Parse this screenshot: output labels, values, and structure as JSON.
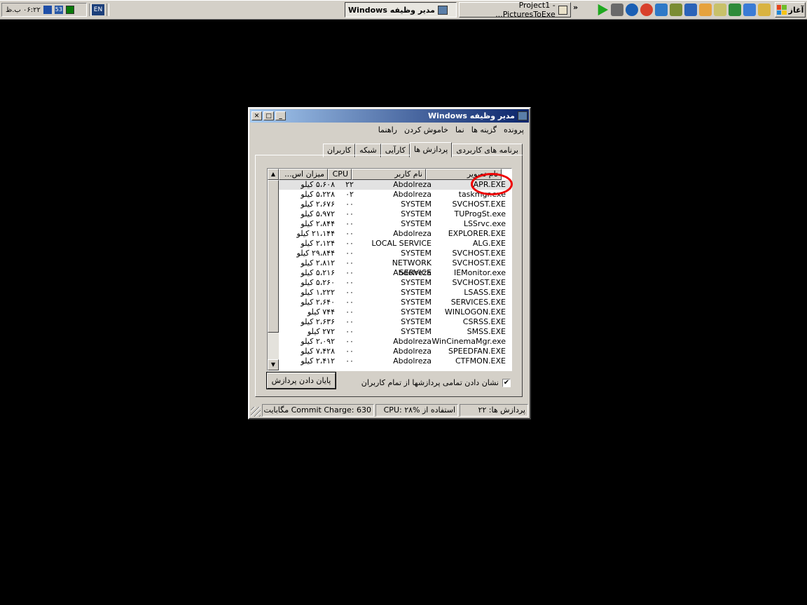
{
  "taskbar": {
    "start_label": "آغاز",
    "tasks": [
      {
        "label": "Project1 - PicturesToExe..."
      },
      {
        "label": "مدير وظيفه Windows"
      }
    ],
    "lang": "EN",
    "clock": "۰۶:۲۲ ب.ظ"
  },
  "window": {
    "title": "مدير وظيفه Windows",
    "menu": [
      "پرونده",
      "گزينه ها",
      "نما",
      "خاموش کردن",
      "راهنما"
    ],
    "tabs": [
      "برنامه های کاربردی",
      "پردازش ها",
      "کارآيی",
      "شبکه",
      "کاربران"
    ],
    "columns": [
      "نام تصوير",
      "نام کاربر",
      "CPU",
      "ميزان اس..."
    ],
    "rows": [
      {
        "name": "APR.EXE",
        "user": "Abdolreza",
        "cpu": "۲۲",
        "mem": "۵،۶۰۸ کيلو"
      },
      {
        "name": "taskmgr.exe",
        "user": "Abdolreza",
        "cpu": "۰۲",
        "mem": "۵،۲۲۸ کيلو"
      },
      {
        "name": "SVCHOST.EXE",
        "user": "SYSTEM",
        "cpu": "۰۰",
        "mem": "۲،۶۷۶ کيلو"
      },
      {
        "name": "TUProgSt.exe",
        "user": "SYSTEM",
        "cpu": "۰۰",
        "mem": "۵،۹۷۲ کيلو"
      },
      {
        "name": "LSSrvc.exe",
        "user": "SYSTEM",
        "cpu": "۰۰",
        "mem": "۲،۸۴۴ کيلو"
      },
      {
        "name": "EXPLORER.EXE",
        "user": "Abdolreza",
        "cpu": "۰۰",
        "mem": "۲۱،۱۴۴ کيلو"
      },
      {
        "name": "ALG.EXE",
        "user": "LOCAL SERVICE",
        "cpu": "۰۰",
        "mem": "۲،۱۲۴ کيلو"
      },
      {
        "name": "SVCHOST.EXE",
        "user": "SYSTEM",
        "cpu": "۰۰",
        "mem": "۲۹،۸۴۴ کيلو"
      },
      {
        "name": "SVCHOST.EXE",
        "user": "NETWORK SERVICE",
        "cpu": "۰۰",
        "mem": "۲،۸۱۲ کيلو"
      },
      {
        "name": "IEMonitor.exe",
        "user": "Abdolreza",
        "cpu": "۰۰",
        "mem": "۵،۲۱۶ کيلو"
      },
      {
        "name": "SVCHOST.EXE",
        "user": "SYSTEM",
        "cpu": "۰۰",
        "mem": "۵،۲۶۰ کيلو"
      },
      {
        "name": "LSASS.EXE",
        "user": "SYSTEM",
        "cpu": "۰۰",
        "mem": "۱،۲۲۲ کيلو"
      },
      {
        "name": "SERVICES.EXE",
        "user": "SYSTEM",
        "cpu": "۰۰",
        "mem": "۲،۶۴۰ کيلو"
      },
      {
        "name": "WINLOGON.EXE",
        "user": "SYSTEM",
        "cpu": "۰۰",
        "mem": "۷۴۴ کيلو"
      },
      {
        "name": "CSRSS.EXE",
        "user": "SYSTEM",
        "cpu": "۰۰",
        "mem": "۲،۶۳۶ کيلو"
      },
      {
        "name": "SMSS.EXE",
        "user": "SYSTEM",
        "cpu": "۰۰",
        "mem": "۲۷۲ کيلو"
      },
      {
        "name": "WinCinemaMgr.exe",
        "user": "Abdolreza",
        "cpu": "۰۰",
        "mem": "۲،۰۹۲ کيلو"
      },
      {
        "name": "SPEEDFAN.EXE",
        "user": "Abdolreza",
        "cpu": "۰۰",
        "mem": "۷،۴۲۸ کيلو"
      },
      {
        "name": "CTFMON.EXE",
        "user": "Abdolreza",
        "cpu": "۰۰",
        "mem": "۲،۴۱۲ کيلو"
      }
    ],
    "show_all_label": "نشان دادن تمامی پردازشها از تمام کاربران",
    "end_process_label": "پايان دادن پردازش",
    "status": {
      "processes": "پردازش ها: ۲۲",
      "cpu": "استفاده از CPU: ۲۸%",
      "commit": "Commit Charge: 630 مگابايت /"
    }
  }
}
